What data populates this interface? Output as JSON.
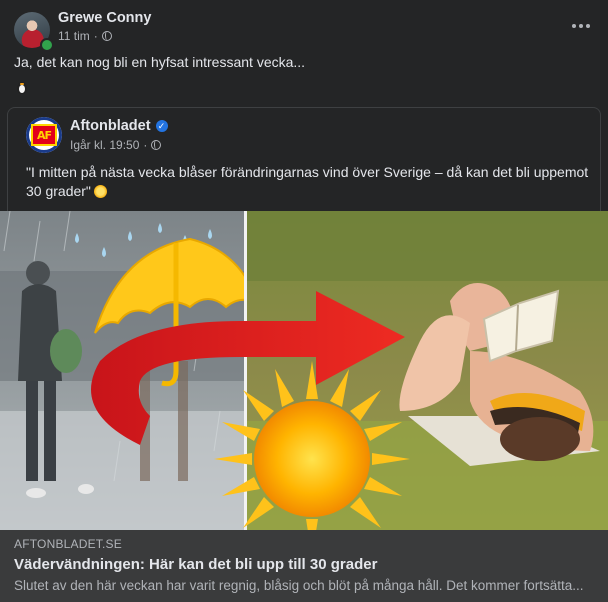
{
  "post": {
    "author": "Grewe Conny",
    "time": "11 tim",
    "separator": "·",
    "text": "Ja, det kan nog bli en hyfsat intressant vecka...",
    "emoji": "penguin"
  },
  "shared_post": {
    "page_name": "Aftonbladet",
    "verified": true,
    "logo_text": "AF",
    "time": "Igår kl. 19:50",
    "separator": "·",
    "quote": "\"I mitten på nästa vecka blåser förändringarnas vind över Sverige – då kan det bli uppemot 30 grader\"",
    "quote_emoji": "sun"
  },
  "link_preview": {
    "domain": "AFTONBLADET.SE",
    "headline": "Vädervändningen: Här kan det bli upp till 30 grader",
    "description": "Slutet av den här veckan har varit regnig, blåsig och blöt på många håll. Det kommer fortsätta..."
  },
  "colors": {
    "background": "#242526",
    "link_box": "#3a3b3c",
    "primary_text": "#e4e6eb",
    "secondary_text": "#b0b3b8",
    "verified_blue": "#2374e1",
    "online_green": "#31a24c",
    "arrow_red": "#e0201d"
  }
}
